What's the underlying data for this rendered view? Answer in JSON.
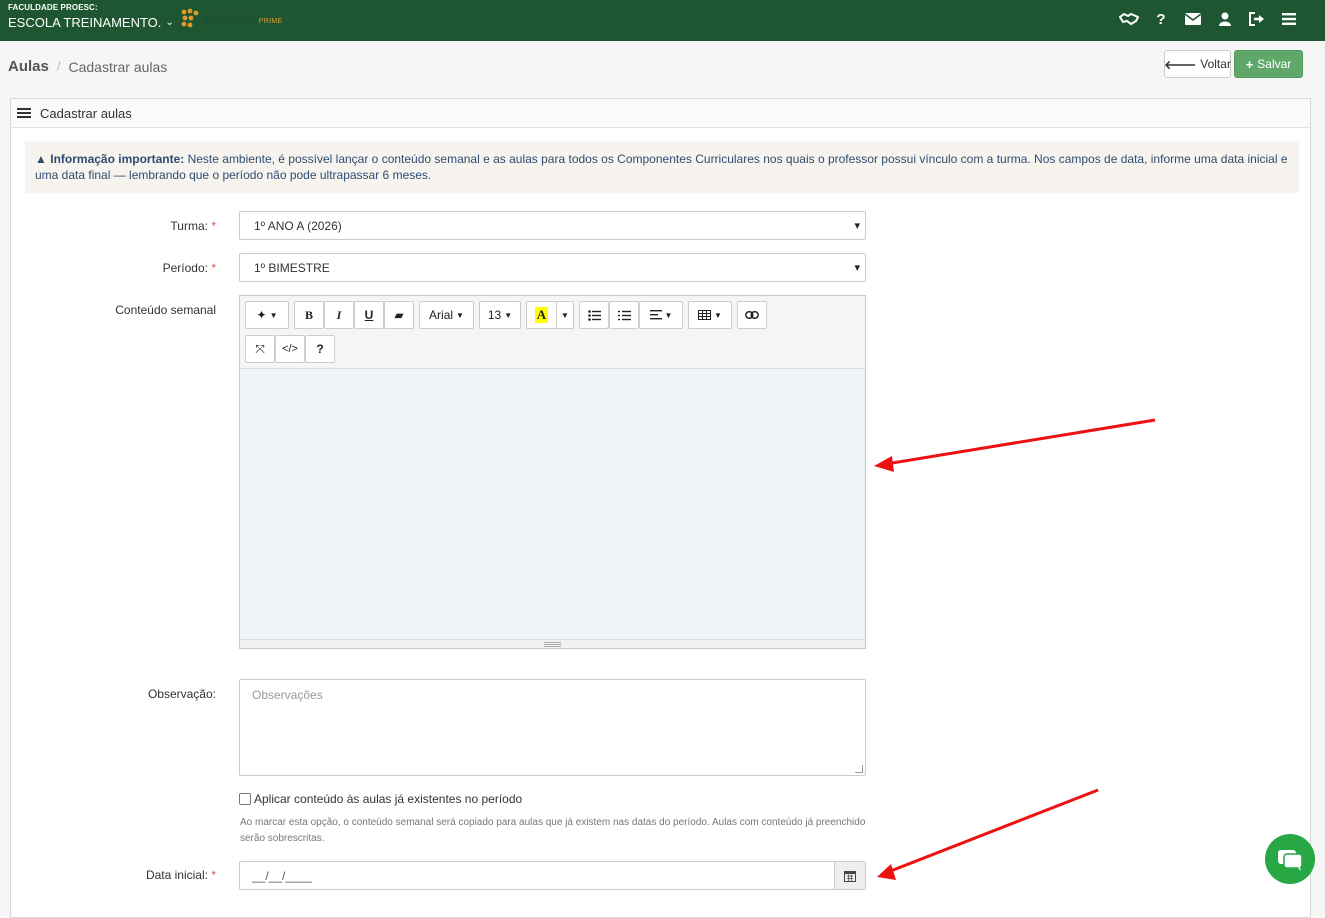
{
  "topbar": {
    "school_kicker": "FACULDADE PROESC:",
    "school_name": "ESCOLA TREINAMENTO.",
    "brand": "proesc",
    "brand_sub": "PRIME",
    "icons": [
      "handshake-icon",
      "help-icon",
      "mail-icon",
      "user-icon",
      "logout-icon",
      "menu-icon"
    ],
    "help_glyph": "?",
    "color": "#1e5631"
  },
  "breadcrumb": {
    "root": "Aulas",
    "separator": "/",
    "current": "Cadastrar aulas"
  },
  "actions": {
    "back_label": "Voltar",
    "save_label": "Salvar",
    "save_color": "#5fa86a"
  },
  "panel": {
    "title": "Cadastrar aulas"
  },
  "alert": {
    "strong": "Informação importante:",
    "text": " Neste ambiente, é possível lançar o conteúdo semanal e as aulas para todos os Componentes Curriculares nos quais o professor possui vínculo com a turma. Nos campos de data, informe uma data inicial e uma data final — lembrando que o período não pode ultrapassar 6 meses."
  },
  "form": {
    "turma_label": "Turma:",
    "turma_value": "1º ANO A (2026)",
    "periodo_label": "Período:",
    "periodo_value": "1º BIMESTRE",
    "required_mark": "*",
    "conteudo_label": "Conteúdo semanal",
    "editor": {
      "font_name": "Arial",
      "font_size": "13",
      "bold": "B",
      "italic": "I",
      "underline": "U",
      "highlight": "A",
      "code": "</>",
      "help": "?"
    },
    "observacao_label": "Observação:",
    "observacao_placeholder": "Observações",
    "checkbox_label": "Aplicar conteúdo às aulas já existentes no período",
    "checkbox_help": "Ao marcar esta opção, o conteúdo semanal será copiado para aulas que já existem nas datas do período. Aulas com conteúdo já preenchido serão sobrescritas.",
    "data_inicial_label": "Data inicial:",
    "data_inicial_mask": "__/__/____"
  }
}
